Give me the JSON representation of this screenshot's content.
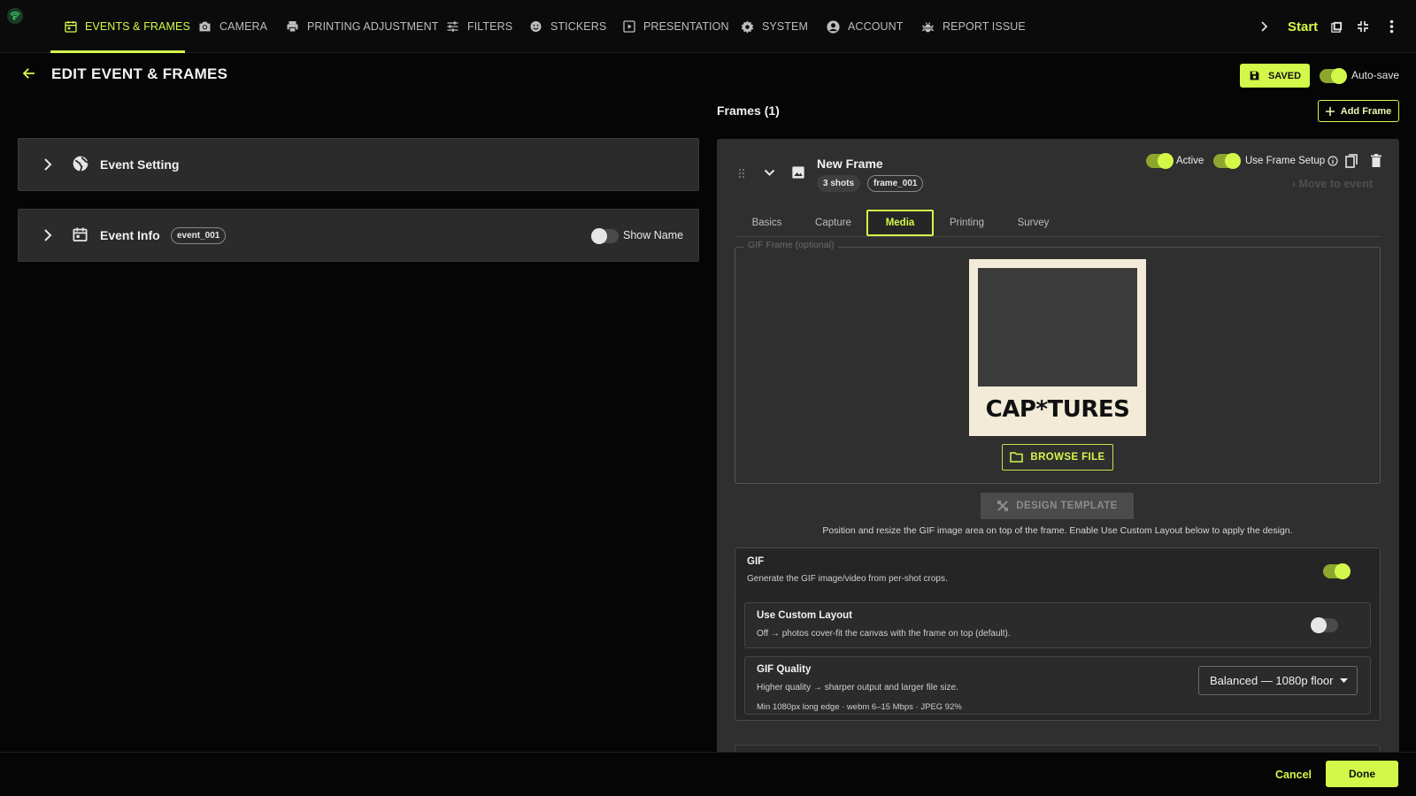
{
  "nav": {
    "items": [
      {
        "label": "EVENTS & FRAMES",
        "icon": "calendar-icon",
        "active": true
      },
      {
        "label": "CAMERA",
        "icon": "camera-icon"
      },
      {
        "label": "PRINTING ADJUSTMENT",
        "icon": "printer-icon"
      },
      {
        "label": "FILTERS",
        "icon": "sliders-icon"
      },
      {
        "label": "STICKERS",
        "icon": "smiley-icon"
      },
      {
        "label": "PRESENTATION",
        "icon": "play-icon"
      },
      {
        "label": "SYSTEM",
        "icon": "gear-icon"
      },
      {
        "label": "ACCOUNT",
        "icon": "account-icon"
      },
      {
        "label": "REPORT ISSUE",
        "icon": "bug-icon"
      }
    ],
    "start_label": "Start"
  },
  "header": {
    "title": "EDIT EVENT & FRAMES",
    "saved_label": "SAVED",
    "autosave_label": "Auto-save",
    "autosave_on": true
  },
  "left": {
    "event_setting": {
      "title": "Event Setting"
    },
    "event_info": {
      "title": "Event Info",
      "chip": "event_001",
      "show_name_label": "Show Name",
      "show_name_on": false
    }
  },
  "frames": {
    "title": "Frames (1)",
    "add_label": "Add Frame",
    "frame": {
      "name": "New Frame",
      "shots_chip": "3 shots",
      "id_chip": "frame_001",
      "active_label": "Active",
      "use_setup_label": "Use Frame Setup",
      "move_label": "Move to event",
      "tabs": [
        "Basics",
        "Capture",
        "Media",
        "Printing",
        "Survey"
      ],
      "active_tab": "Media",
      "gif_frame_legend": "GIF Frame (optional)",
      "frame_brand": "CAP*TURES",
      "browse_label": "BROWSE FILE",
      "design_label": "DESIGN TEMPLATE",
      "hint": "Position and resize the GIF image area on top of the frame. Enable Use Custom Layout below to apply the design.",
      "gif": {
        "label": "GIF",
        "desc": "Generate the GIF image/video from per-shot crops.",
        "on": true
      },
      "custom_layout": {
        "label": "Use Custom Layout",
        "desc": "Off → photos cover-fit the canvas with the frame on top (default).",
        "on": false
      },
      "quality": {
        "label": "GIF Quality",
        "desc": "Higher quality → sharper output and larger file size.",
        "detail": "Min 1080px long edge · webm 6–15 Mbps · JPEG 92%",
        "selected": "Balanced — 1080p floor"
      }
    }
  },
  "footer": {
    "cancel_label": "Cancel",
    "done_label": "Done"
  },
  "colors": {
    "accent": "#d4f84a",
    "background": "#050505",
    "panel": "#2f2f2f"
  }
}
